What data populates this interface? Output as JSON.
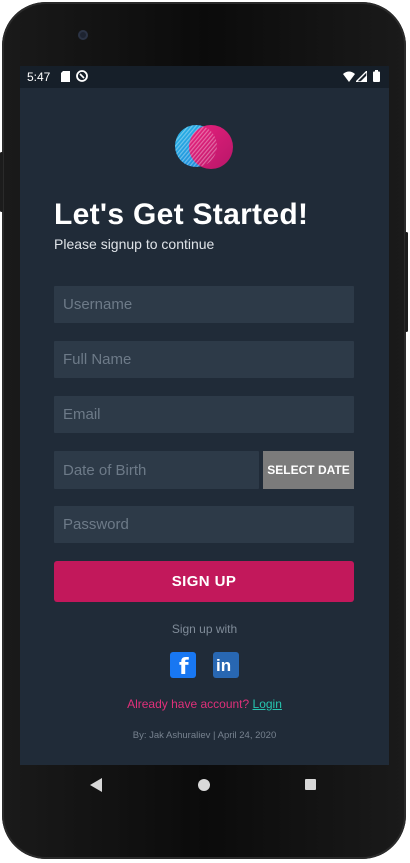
{
  "status_bar": {
    "time": "5:47",
    "icons": [
      "sd-card-icon",
      "notification-icon",
      "wifi-icon",
      "signal-icon",
      "battery-icon"
    ]
  },
  "header": {
    "title": "Let's Get Started!",
    "subtitle": "Please signup to continue"
  },
  "form": {
    "username_placeholder": "Username",
    "fullname_placeholder": "Full Name",
    "email_placeholder": "Email",
    "dob_placeholder": "Date of Birth",
    "select_date_label": "SELECT DATE",
    "password_placeholder": "Password",
    "signup_label": "SIGN UP"
  },
  "social": {
    "label": "Sign up with",
    "items": [
      "facebook-icon",
      "linkedin-icon"
    ]
  },
  "footer": {
    "account_prompt": "Already have account?",
    "login_link": "Login",
    "credit": "By: Jak Ashuraliev | April 24, 2020"
  },
  "colors": {
    "background": "#202b38",
    "input_bg": "#2d3a48",
    "primary": "#c2185b",
    "link": "#26c6b0",
    "prompt": "#e0307a"
  }
}
